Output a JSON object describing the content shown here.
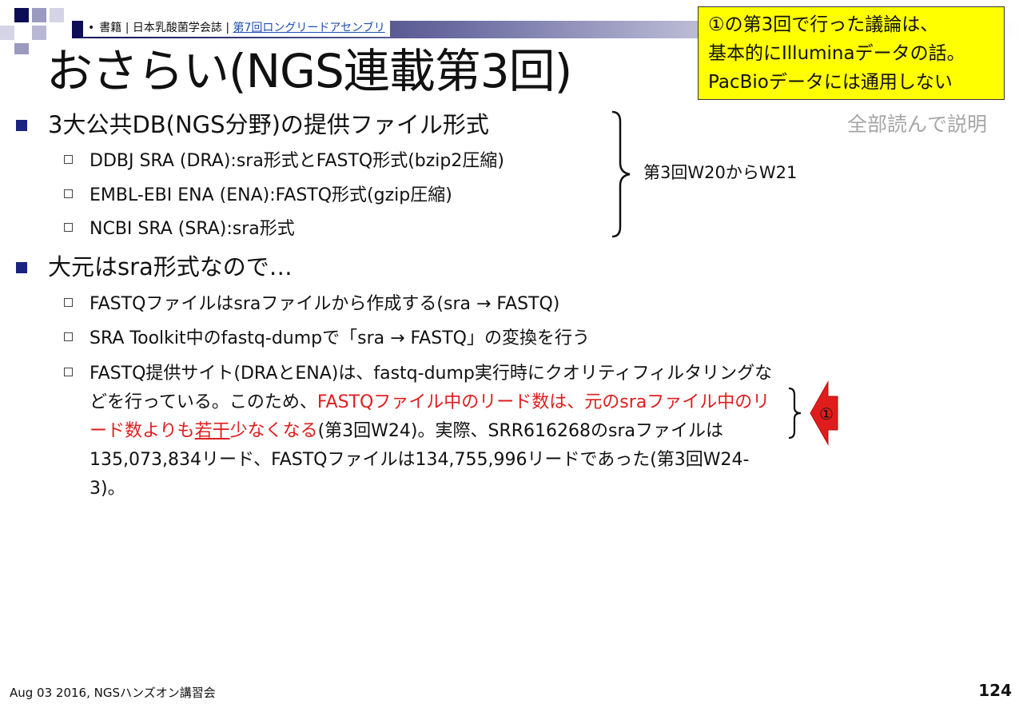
{
  "header": {
    "bullet": "•",
    "crumb_text": "書籍 | 日本乳酸菌学会誌 | ",
    "crumb_link": "第7回ロングリードアセンブリ"
  },
  "title": "おさらい(NGS連載第3回)",
  "callout": {
    "line1": "①の第3回で行った議論は、",
    "line2": "基本的にIlluminaデータの話。",
    "line3": "PacBioデータには通用しない"
  },
  "note_grey": "全部読んで説明",
  "section1": {
    "heading": "3大公共DB(NGS分野)の提供ファイル形式",
    "items": [
      "DDBJ SRA (DRA):sra形式とFASTQ形式(bzip2圧縮)",
      "EMBL-EBI ENA (ENA):FASTQ形式(gzip圧縮)",
      "NCBI SRA (SRA):sra形式"
    ],
    "brace_note": "第3回W20からW21"
  },
  "section2": {
    "heading": "大元はsra形式なので…",
    "items": [
      "FASTQファイルはsraファイルから作成する(sra → FASTQ)",
      "SRA Toolkit中のfastq-dumpで「sra → FASTQ」の変換を行う"
    ],
    "para": {
      "p1": "FASTQ提供サイト(DRAとENA)は、fastq-dump実行時にクオリティフィルタリングなどを行っている。このため、",
      "red1": "FASTQファイル中のリード数は、元のsraファイル中のリード数よりも",
      "red_u": "若干",
      "red2": "少なくなる",
      "p2": "(第3回W24)。実際、SRR616268のsraファイルは135,073,834リード、FASTQファイルは134,755,996リードであった(第3回W24-3)。"
    },
    "arrow_label": "①"
  },
  "footer": {
    "left": "Aug 03 2016, NGSハンズオン講習会",
    "page": "124"
  },
  "colors": {
    "accent_red": "#e01d1d",
    "callout_bg": "#ffff00",
    "bullet_navy": "#1a237e"
  }
}
